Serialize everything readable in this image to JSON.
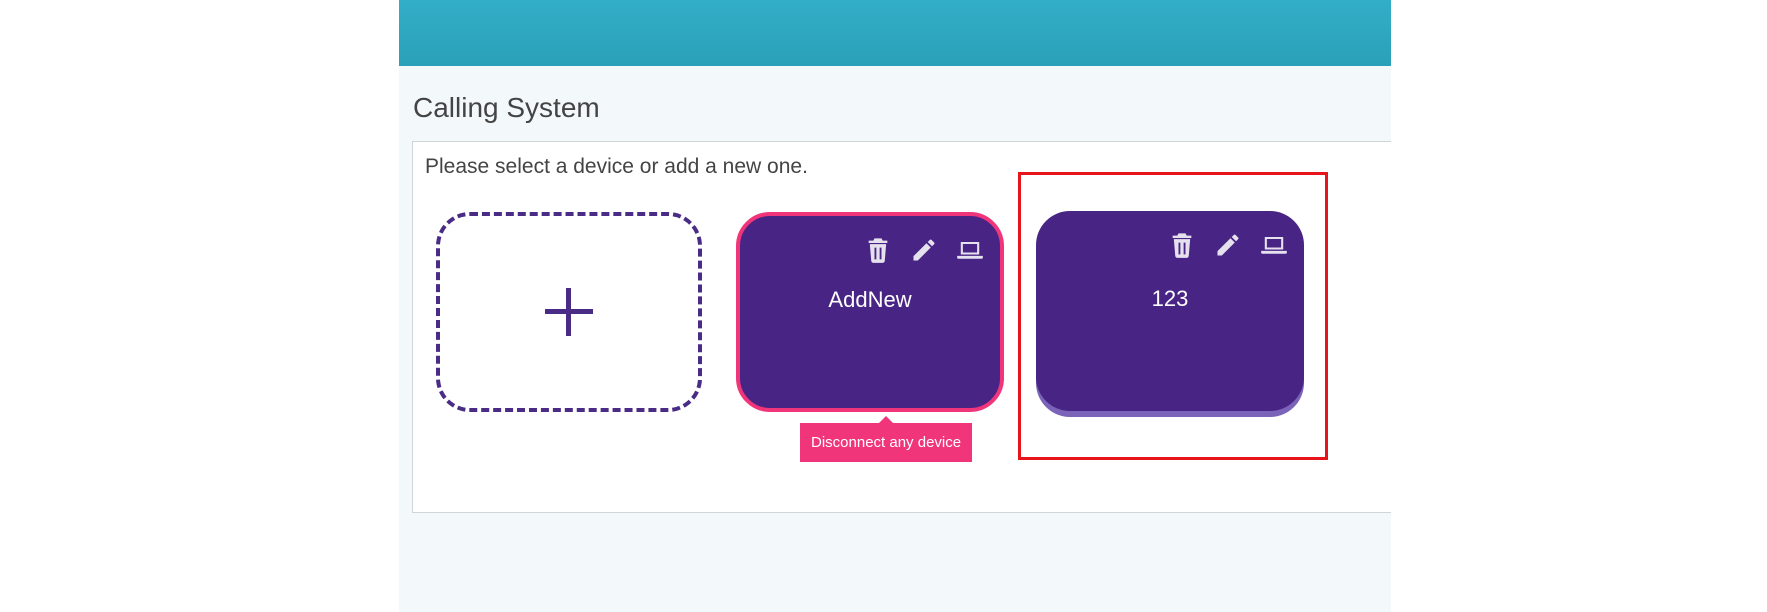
{
  "page": {
    "title": "Calling System",
    "instructions": "Please select a device or add a new one."
  },
  "devices": [
    {
      "name": "AddNew",
      "selected": true,
      "tooltip": "Disconnect any device"
    },
    {
      "name": "123",
      "selected": false
    }
  ],
  "icons": {
    "delete": "trash-icon",
    "edit": "pencil-icon",
    "connect": "laptop-icon",
    "add": "plus-icon"
  },
  "colors": {
    "header": "#2ea6bf",
    "tile": "#482584",
    "selected_border": "#f0357a",
    "tooltip": "#f0357a",
    "highlight": "#e8141b"
  }
}
